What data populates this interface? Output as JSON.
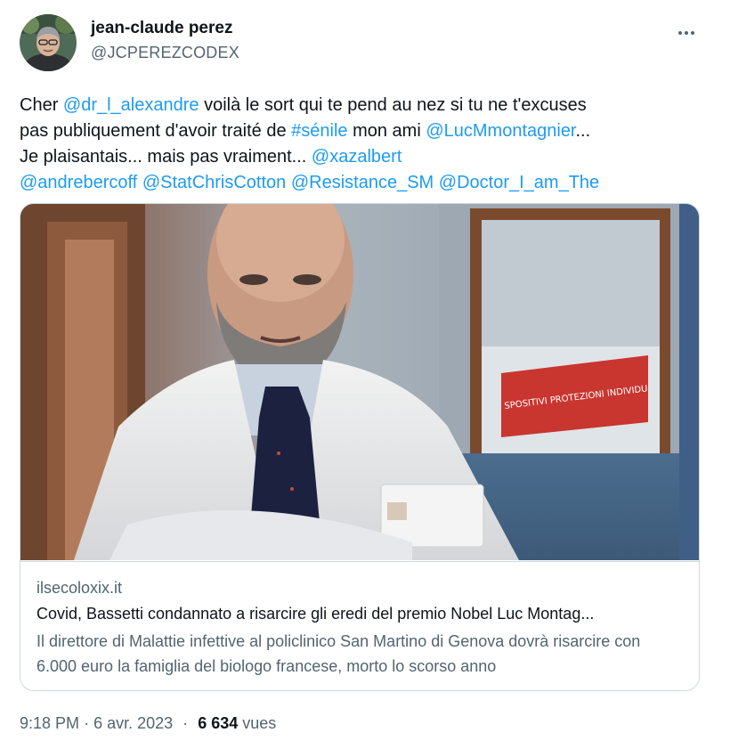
{
  "author": {
    "display_name": "jean-claude perez",
    "handle": "@JCPEREZCODEX"
  },
  "tweet": {
    "lines": [
      [
        {
          "text": "Cher ",
          "link": false
        },
        {
          "text": "@dr_l_alexandre",
          "link": true
        },
        {
          "text": " voilà le sort qui te pend au nez si tu ne t'excuses",
          "link": false
        }
      ],
      [
        {
          "text": "pas publiquement d'avoir traité de ",
          "link": false
        },
        {
          "text": "#sénile",
          "link": true
        },
        {
          "text": " mon ami ",
          "link": false
        },
        {
          "text": "@LucMmontagnier",
          "link": true
        },
        {
          "text": "...",
          "link": false
        }
      ],
      [
        {
          "text": "Je plaisantais... mais pas vraiment... ",
          "link": false
        },
        {
          "text": "@xazalbert",
          "link": true
        }
      ],
      [
        {
          "text": "@andrebercoff",
          "link": true
        },
        {
          "text": " ",
          "link": false
        },
        {
          "text": "@StatChrisCotton",
          "link": true
        },
        {
          "text": " ",
          "link": false
        },
        {
          "text": "@Resistance_SM",
          "link": true
        },
        {
          "text": " ",
          "link": false
        },
        {
          "text": "@Doctor_I_am_The",
          "link": true
        }
      ]
    ]
  },
  "card": {
    "domain": "ilsecoloxix.it",
    "title": "Covid, Bassetti condannato a risarcire gli eredi del premio Nobel Luc Montag...",
    "description": "Il direttore di Malattie infettive al policlinico San Martino di Genova dovrà risarcire con 6.000 euro la famiglia del biologo francese, morto lo scorso anno",
    "image_sign_text": "SPOSITIVI PROTEZIONI INDIVIDU"
  },
  "meta": {
    "time": "9:18 PM",
    "separator": "·",
    "date": "6 avr. 2023",
    "views_count": "6 634",
    "views_label": "vues"
  },
  "icons": {
    "more": "more-options-icon"
  },
  "colors": {
    "link": "#1d9bf0",
    "secondary_text": "#536471",
    "primary_text": "#0f1419",
    "border": "#cfd9de"
  }
}
